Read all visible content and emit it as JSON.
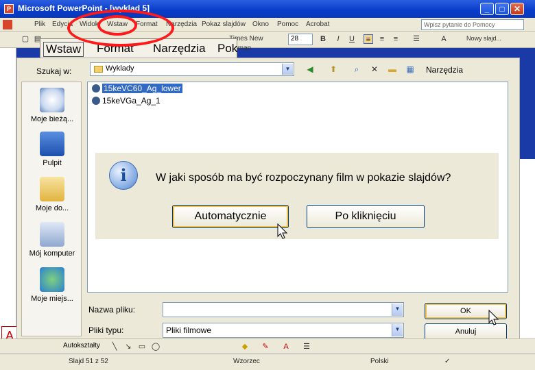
{
  "titlebar": {
    "title": "Microsoft PowerPoint - [wyklad 5]",
    "app_icon_letter": "P",
    "buttons": {
      "minimize": "_",
      "maximize": "□",
      "close": "✕"
    }
  },
  "menubar": {
    "items": [
      "Plik",
      "Edycja",
      "Widok",
      "Wstaw",
      "Format",
      "Narzędzia",
      "Pokaz slajdów",
      "Okno",
      "Pomoc",
      "Acrobat"
    ],
    "help_placeholder": "Wpisz pytanie do Pomocy"
  },
  "toolbar": {
    "font_name": "Times New Roman",
    "font_size": "28",
    "bold": "B",
    "italic": "I",
    "underline": "U",
    "new_slide": "Nowy slajd..."
  },
  "zoom_menu": {
    "items": [
      "Wstaw",
      "Format",
      "Narzędzia",
      "Pok"
    ]
  },
  "dialog": {
    "lookin_label": "Szukaj w:",
    "lookin_value": "Wyklady",
    "tools_menu": "Narzędzia",
    "places": [
      "Moje bieżą...",
      "Pulpit",
      "Moje do...",
      "Mój komputer",
      "Moje miejs..."
    ],
    "files": [
      {
        "name": "15keVC60_Ag_lower",
        "selected": true
      },
      {
        "name": "15keVGa_Ag_1",
        "selected": false
      }
    ],
    "filename_label": "Nazwa pliku:",
    "filename_value": "",
    "filetype_label": "Pliki typu:",
    "filetype_value": "Pliki filmowe",
    "ok_label": "OK",
    "cancel_label": "Anuluj"
  },
  "popup": {
    "question": "W jaki sposób ma być rozpoczynany film w pokazie slajdów?",
    "auto_button": "Automatycznie",
    "click_button": "Po kliknięciu"
  },
  "drawbar": {
    "autoshapes": "Autokształty"
  },
  "statusbar": {
    "slide": "Slajd 51 z 52",
    "design": "Wzorzec",
    "language": "Polski"
  },
  "slide_fragment": {
    "letter": "A"
  },
  "colors": {
    "titlebar": "#0a3cc8",
    "selection": "#316ac5",
    "annotation": "#ff1a1a",
    "dialog_bg": "#ece9d8"
  }
}
